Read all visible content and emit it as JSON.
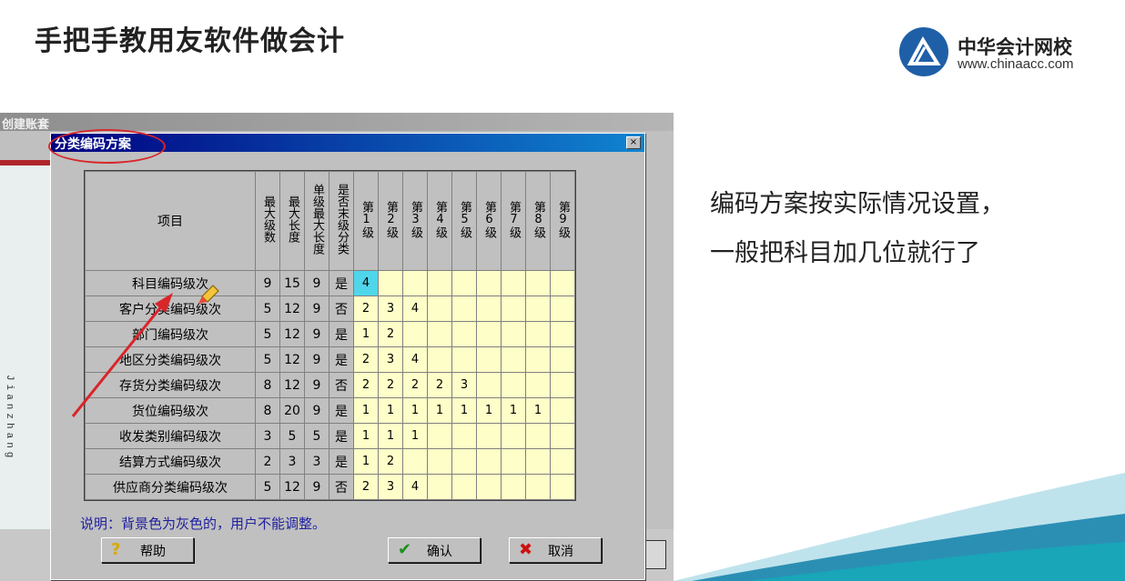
{
  "slide": {
    "title": "手把手教用友软件做会计",
    "logo_name": "中华会计网校",
    "logo_url": "www.chinaacc.com",
    "note_line1": "编码方案按实际情况设置，",
    "note_line2": "一般把科目加几位就行了"
  },
  "background_window": {
    "title": "创建账套",
    "side_text": "Jianzhang"
  },
  "dialog": {
    "title": "分类编码方案",
    "close_glyph": "×",
    "columns": {
      "item": "项目",
      "max_levels": "最大级数",
      "max_length": "最大长度",
      "single_max": "单级最大长度",
      "detail_only": "是否末级分类",
      "levels": [
        "第1级",
        "第2级",
        "第3级",
        "第4级",
        "第5级",
        "第6级",
        "第7级",
        "第8级",
        "第9级"
      ]
    },
    "rows": [
      {
        "name": "科目编码级次",
        "max_levels": "9",
        "max_length": "15",
        "single_max": "9",
        "detail_only": "是",
        "levels": [
          "4",
          "",
          "",
          "",
          "",
          "",
          "",
          "",
          ""
        ]
      },
      {
        "name": "客户分类编码级次",
        "max_levels": "5",
        "max_length": "12",
        "single_max": "9",
        "detail_only": "否",
        "levels": [
          "2",
          "3",
          "4",
          "",
          "",
          "",
          "",
          "",
          ""
        ]
      },
      {
        "name": "部门编码级次",
        "max_levels": "5",
        "max_length": "12",
        "single_max": "9",
        "detail_only": "是",
        "levels": [
          "1",
          "2",
          "",
          "",
          "",
          "",
          "",
          "",
          ""
        ]
      },
      {
        "name": "地区分类编码级次",
        "max_levels": "5",
        "max_length": "12",
        "single_max": "9",
        "detail_only": "是",
        "levels": [
          "2",
          "3",
          "4",
          "",
          "",
          "",
          "",
          "",
          ""
        ]
      },
      {
        "name": "存货分类编码级次",
        "max_levels": "8",
        "max_length": "12",
        "single_max": "9",
        "detail_only": "否",
        "levels": [
          "2",
          "2",
          "2",
          "2",
          "3",
          "",
          "",
          "",
          ""
        ]
      },
      {
        "name": "货位编码级次",
        "max_levels": "8",
        "max_length": "20",
        "single_max": "9",
        "detail_only": "是",
        "levels": [
          "1",
          "1",
          "1",
          "1",
          "1",
          "1",
          "1",
          "1",
          ""
        ]
      },
      {
        "name": "收发类别编码级次",
        "max_levels": "3",
        "max_length": "5",
        "single_max": "5",
        "detail_only": "是",
        "levels": [
          "1",
          "1",
          "1",
          "",
          "",
          "",
          "",
          "",
          ""
        ]
      },
      {
        "name": "结算方式编码级次",
        "max_levels": "2",
        "max_length": "3",
        "single_max": "3",
        "detail_only": "是",
        "levels": [
          "1",
          "2",
          "",
          "",
          "",
          "",
          "",
          "",
          ""
        ]
      },
      {
        "name": "供应商分类编码级次",
        "max_levels": "5",
        "max_length": "12",
        "single_max": "9",
        "detail_only": "否",
        "levels": [
          "2",
          "3",
          "4",
          "",
          "",
          "",
          "",
          "",
          ""
        ]
      }
    ],
    "explain": "说明：背景色为灰色的，用户不能调整。",
    "buttons": {
      "help": "帮助",
      "ok": "确认",
      "cancel": "取消"
    },
    "icons": {
      "help": "question-icon",
      "ok": "checkmark-icon",
      "cancel": "x-mark-icon"
    }
  },
  "colors": {
    "dialog_title_start": "#000080",
    "dialog_title_end": "#1084d0",
    "editable_cell": "#fefec8",
    "selected_cell": "#4fd6ea",
    "annotation_red": "#d8262a",
    "logo_blue": "#1f5fa8"
  }
}
